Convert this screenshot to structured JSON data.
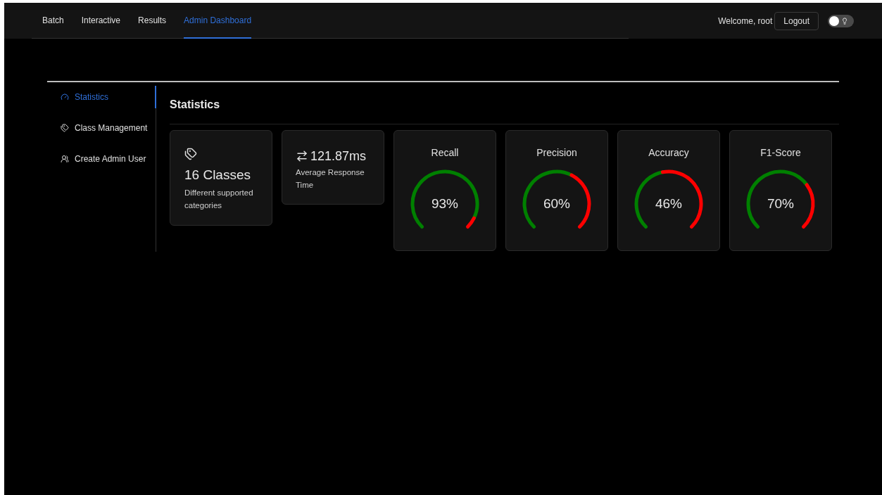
{
  "nav": {
    "items": [
      {
        "label": "Batch",
        "selected": false
      },
      {
        "label": "Interactive",
        "selected": false
      },
      {
        "label": "Results",
        "selected": false
      },
      {
        "label": "Admin Dashboard",
        "selected": true
      }
    ],
    "welcome": "Welcome, root",
    "logout": "Logout",
    "theme_toggle": {
      "on": false
    }
  },
  "sidebar": {
    "items": [
      {
        "label": "Statistics",
        "selected": true
      },
      {
        "label": "Class Management",
        "selected": false
      },
      {
        "label": "Create Admin User",
        "selected": false
      }
    ]
  },
  "main": {
    "heading": "Statistics",
    "cards": [
      {
        "kind": "classes",
        "value": "16 Classes",
        "caption": "Different supported categories"
      },
      {
        "kind": "response",
        "value": "121.87ms",
        "caption": "Average Response Time"
      }
    ],
    "gauges": [
      {
        "title": "Recall",
        "reading": "93%"
      },
      {
        "title": "Precision",
        "reading": "60%"
      },
      {
        "title": "Accuracy",
        "reading": "46%"
      },
      {
        "title": "F1-Score",
        "reading": "70%"
      }
    ]
  }
}
